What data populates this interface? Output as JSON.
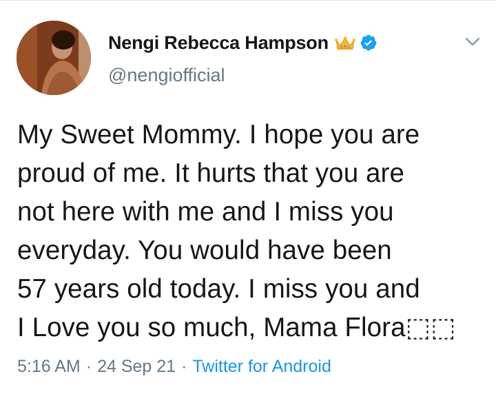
{
  "tweet": {
    "author": {
      "display_name": "Nengi Rebecca Hampson",
      "handle": "@nengiofficial",
      "badges": [
        "crown-emoji",
        "verified-icon"
      ]
    },
    "text": "My Sweet Mommy. I hope you are\nproud of me. It hurts that you are\nnot here with me and I miss you\neveryday. You would have been\n57 years old today. I miss you and\nI Love you so much, Mama Flora⬚⬚",
    "time": "5:16 AM",
    "separator": "·",
    "date": "24 Sep 21",
    "source": "Twitter for Android"
  },
  "colors": {
    "text_primary": "#14171a",
    "text_secondary": "#657786",
    "link": "#1b95e0",
    "verified": "#1da1f2",
    "divider": "#e1e8ed"
  },
  "icons": {
    "menu": "chevron-down-icon",
    "verified": "verified-icon",
    "crown": "crown-icon"
  }
}
